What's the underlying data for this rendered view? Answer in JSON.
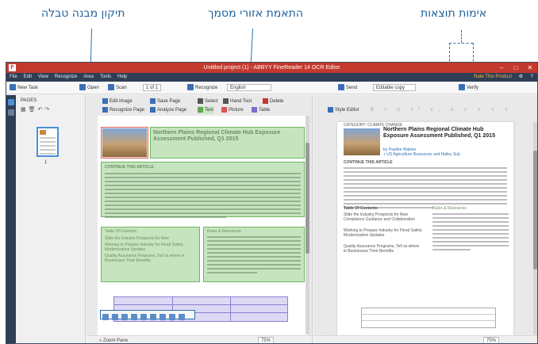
{
  "callouts": {
    "table_fix": "תיקון מבנה טבלה",
    "area_fit": "התאמת אזורי מסמך",
    "verify": "אימות תוצאות"
  },
  "window": {
    "title": "Untitled project (1) - ABBYY FineReader 14 OCR Editor",
    "minimize": "–",
    "maximize": "□",
    "close": "✕"
  },
  "menu": {
    "items": [
      "File",
      "Edit",
      "View",
      "Recognize",
      "Area",
      "Tools",
      "Help"
    ],
    "rate": "Rate This Product"
  },
  "toolbar": {
    "new_task": "New Task",
    "open": "Open",
    "scan": "Scan",
    "page_counter": "1 of 1",
    "recognize": "Recognize",
    "language": "English",
    "send": "Send",
    "mode": "Editable copy",
    "verify": "Verify"
  },
  "pages_panel": {
    "header": "PAGES",
    "thumb_number": "1"
  },
  "image_panel": {
    "edit_image": "Edit Image",
    "save_page": "Save Page",
    "select": "Select",
    "hand_tool": "Hand Tool",
    "delete": "Delete",
    "recognize_page": "Recognize Page",
    "analyze_page": "Analyze Page",
    "text": "Text",
    "picture": "Picture",
    "table": "Table",
    "zoom_pane": "Zoom Pane",
    "zoom": "75%",
    "heading": "Northern Plains Regional Climate Hub Exposure Assessment Published, Q1 2015",
    "section": "CONTINUE THIS ARTICLE",
    "toc": "Table Of Contents",
    "toc_items": [
      "Slide the Industry Prospects for New",
      "Working to Prepare Industry for Flood Safety Modernization Updates",
      "Quality Assurance Programs, Tell us where in Businesses Their Benefits"
    ],
    "side_heading": "Rules & Resources"
  },
  "text_panel": {
    "style_editor": "Style Editor",
    "byline": "CATEGORY: CLIMATE CHANGE",
    "title": "Northern Plains Regional Climate Hub Exposure Assessment Published, Q1 2015",
    "by_1": "by Pauline Wakine",
    "by_2": "+ US Agriculture Resources and Hailey Sub",
    "section": "CONTINUE THIS ARTICLE",
    "toc": "Table Of Contents",
    "toc_items": [
      "Slide the Industry Prospects for New Compliance Guidance and Collaboration",
      "Working to Prepare Industry for Flood Safety Modernization Updates",
      "Quality Assurance Programs, Tell us where in Businesses Their Benefits"
    ],
    "side_heading": "Rules & Resources",
    "zoom": "75%"
  }
}
